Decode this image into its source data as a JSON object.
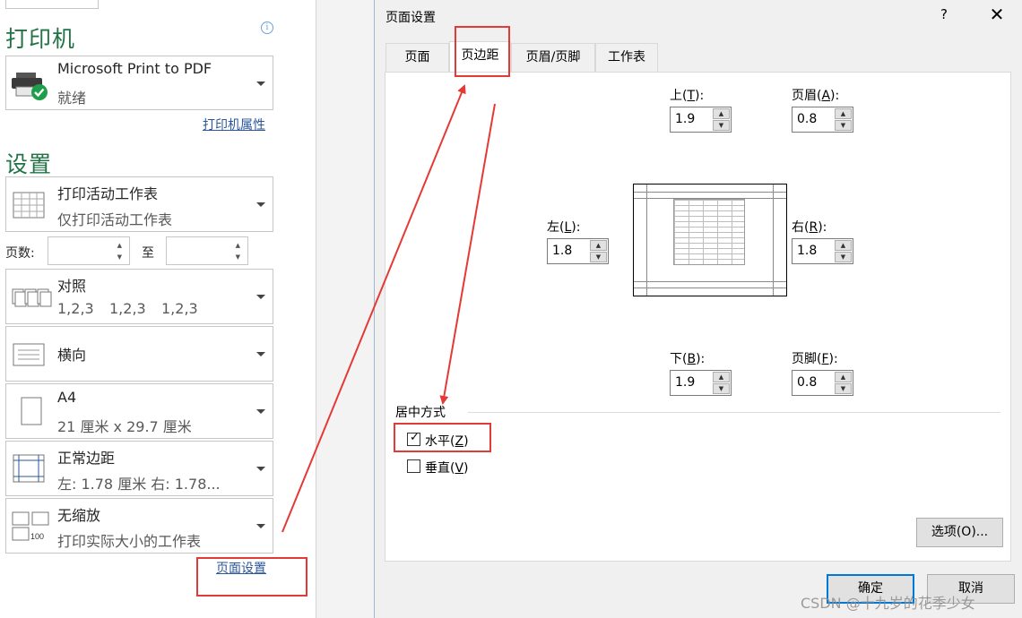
{
  "printer": {
    "section_title": "打印机",
    "name": "Microsoft Print to PDF",
    "status": "就绪",
    "properties_link": "打印机属性",
    "info_icon": "i"
  },
  "settings": {
    "section_title": "设置",
    "what_to_print": {
      "main": "打印活动工作表",
      "sub": "仅打印活动工作表"
    },
    "pages": {
      "label": "页数:",
      "to_label": "至",
      "from_value": "",
      "to_value": ""
    },
    "collation": {
      "main": "对照",
      "sub": [
        "1,2,3",
        "1,2,3",
        "1,2,3"
      ]
    },
    "orientation": {
      "main": "横向"
    },
    "paper": {
      "main": "A4",
      "sub": "21 厘米 x 29.7 厘米"
    },
    "margins": {
      "main": "正常边距",
      "sub": "左:  1.78 厘米     右:  1.78..."
    },
    "scaling": {
      "main": "无缩放",
      "sub": "打印实际大小的工作表",
      "icon_label": "100"
    },
    "page_setup_link": "页面设置"
  },
  "dialog": {
    "title": "页面设置",
    "help": "?",
    "close": "✕",
    "tabs": [
      {
        "label": "页面",
        "active": false
      },
      {
        "label": "页边距",
        "active": true
      },
      {
        "label": "页眉/页脚",
        "active": false
      },
      {
        "label": "工作表",
        "active": false
      }
    ],
    "margins": {
      "top": {
        "label": "上",
        "key": "T",
        "value": "1.9"
      },
      "header": {
        "label": "页眉",
        "key": "A",
        "value": "0.8"
      },
      "left": {
        "label": "左",
        "key": "L",
        "value": "1.8"
      },
      "right": {
        "label": "右",
        "key": "R",
        "value": "1.8"
      },
      "bottom": {
        "label": "下",
        "key": "B",
        "value": "1.9"
      },
      "footer": {
        "label": "页脚",
        "key": "F",
        "value": "0.8"
      }
    },
    "center_on_page": {
      "legend": "居中方式",
      "horizontal": {
        "label": "水平",
        "key": "Z",
        "checked": true
      },
      "vertical": {
        "label": "垂直",
        "key": "V",
        "checked": false
      }
    },
    "options_button": "选项(O)...",
    "ok_button": "确定",
    "cancel_button": "取消"
  },
  "watermark": "CSDN @十九岁的花季少女",
  "colors": {
    "accent_green": "#217346",
    "link_blue": "#2b579a",
    "annotation_red": "#e53935",
    "default_button_border": "#0078d7"
  }
}
